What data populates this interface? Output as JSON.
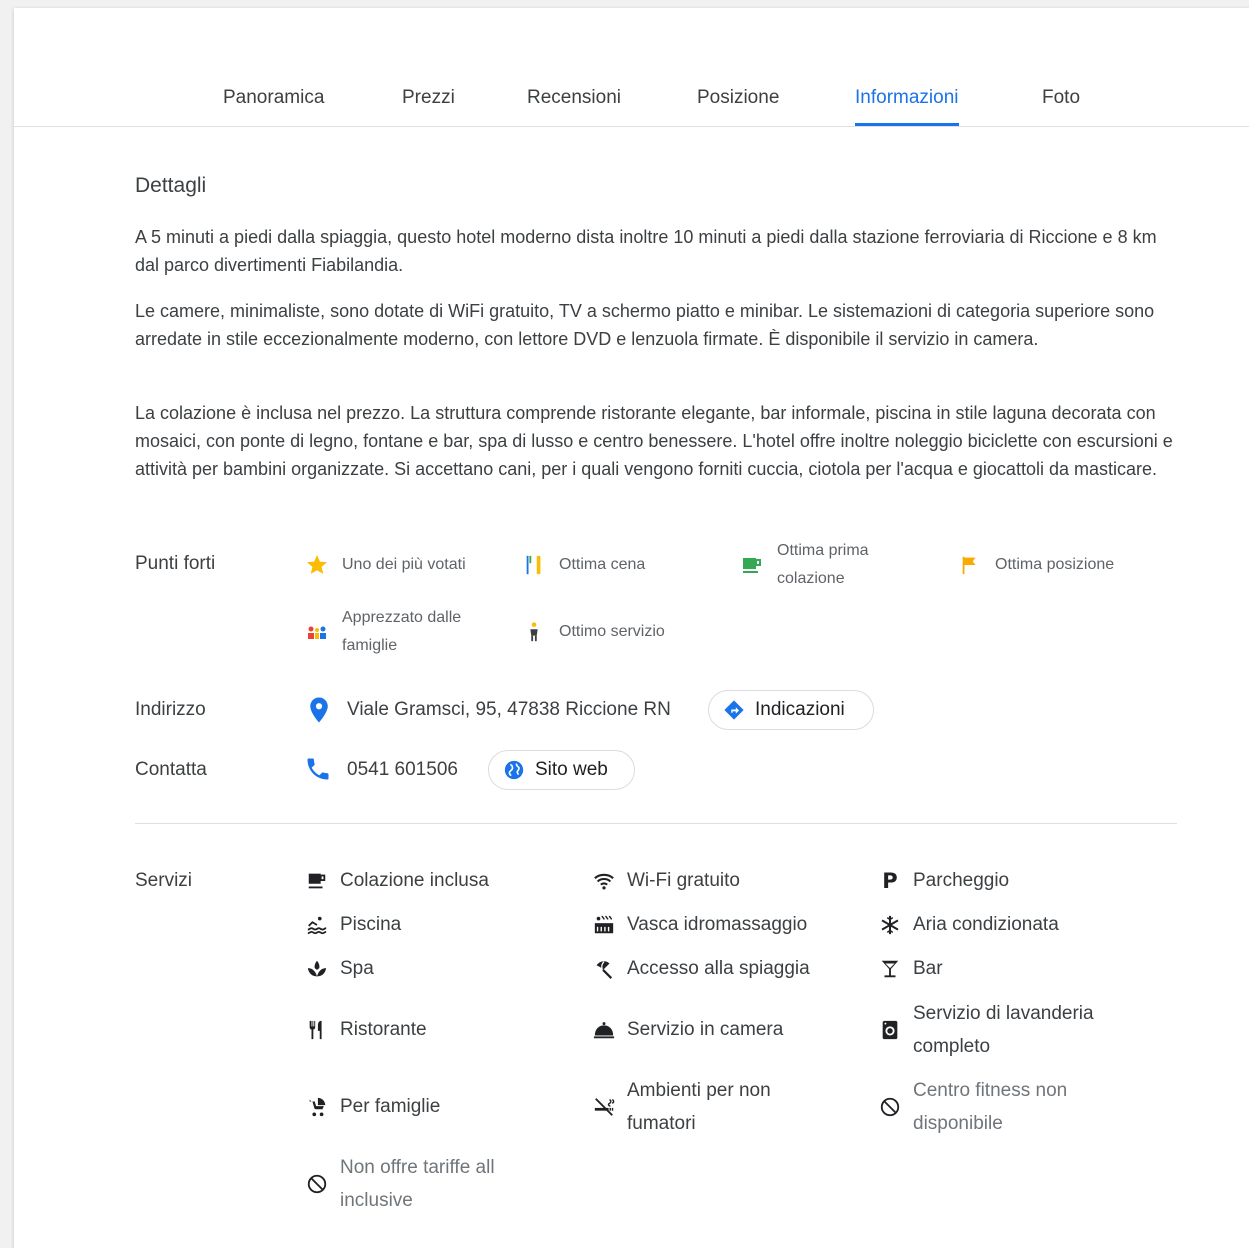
{
  "tabs": [
    {
      "label": "Panoramica",
      "active": false
    },
    {
      "label": "Prezzi",
      "active": false
    },
    {
      "label": "Recensioni",
      "active": false
    },
    {
      "label": "Posizione",
      "active": false
    },
    {
      "label": "Informazioni",
      "active": true
    },
    {
      "label": "Foto",
      "active": false
    }
  ],
  "details": {
    "title": "Dettagli",
    "paragraphs": [
      "A 5 minuti a piedi dalla spiaggia, questo hotel moderno dista inoltre 10 minuti a piedi dalla stazione ferroviaria di Riccione e 8 km dal parco divertimenti Fiabilandia.",
      "Le camere, minimaliste, sono dotate di WiFi gratuito, TV a schermo piatto e minibar. Le sistemazioni di categoria superiore sono arredate in stile eccezionalmente moderno, con lettore DVD e lenzuola firmate. È disponibile il servizio in camera.",
      "La colazione è inclusa nel prezzo. La struttura comprende ristorante elegante, bar informale, piscina in stile laguna decorata con mosaici, con ponte di legno, fontane e bar, spa di lusso e centro benessere. L'hotel offre inoltre noleggio biciclette con escursioni e attività per bambini organizzate. Si accettano cani, per i quali vengono forniti cuccia, ciotola per l'acqua e giocattoli da masticare."
    ]
  },
  "highlights": {
    "label": "Punti forti",
    "items": [
      {
        "text": "Uno dei più votati",
        "icon": "star-icon"
      },
      {
        "text": "Ottima cena",
        "icon": "dinner-icon"
      },
      {
        "text": "Ottima prima colazione",
        "icon": "breakfast-icon"
      },
      {
        "text": "Ottima posizione",
        "icon": "flag-icon"
      },
      {
        "text": "Apprezzato dalle famiglie",
        "icon": "family-icon"
      },
      {
        "text": "Ottimo servizio",
        "icon": "service-icon"
      }
    ]
  },
  "address": {
    "label": "Indirizzo",
    "value": "Viale Gramsci, 95, 47838 Riccione RN",
    "directions_label": "Indicazioni"
  },
  "contact": {
    "label": "Contatta",
    "phone": "0541 601506",
    "website_label": "Sito web"
  },
  "services": {
    "label": "Servizi",
    "items": [
      {
        "text": "Colazione inclusa",
        "icon": "breakfast-icon",
        "available": true
      },
      {
        "text": "Wi-Fi gratuito",
        "icon": "wifi-icon",
        "available": true
      },
      {
        "text": "Parcheggio",
        "icon": "parking-icon",
        "available": true
      },
      {
        "text": "Piscina",
        "icon": "pool-icon",
        "available": true
      },
      {
        "text": "Vasca idromassaggio",
        "icon": "hot-tub-icon",
        "available": true
      },
      {
        "text": "Aria condizionata",
        "icon": "snowflake-icon",
        "available": true
      },
      {
        "text": "Spa",
        "icon": "spa-icon",
        "available": true
      },
      {
        "text": "Accesso alla spiaggia",
        "icon": "beach-icon",
        "available": true
      },
      {
        "text": "Bar",
        "icon": "cocktail-icon",
        "available": true
      },
      {
        "text": "Ristorante",
        "icon": "restaurant-icon",
        "available": true
      },
      {
        "text": "Servizio in camera",
        "icon": "room-service-icon",
        "available": true
      },
      {
        "text": "Servizio di lavanderia completo",
        "icon": "laundry-icon",
        "available": true
      },
      {
        "text": "Per famiglie",
        "icon": "stroller-icon",
        "available": true
      },
      {
        "text": "Ambienti per non fumatori",
        "icon": "no-smoking-icon",
        "available": true
      },
      {
        "text": "Centro fitness non disponibile",
        "icon": "unavailable-icon",
        "available": false
      },
      {
        "text": "Non offre tariffe all inclusive",
        "icon": "unavailable-icon",
        "available": false
      }
    ]
  },
  "colors": {
    "accent": "#1a73e8",
    "text": "#3c4043",
    "muted": "#5f6368",
    "star": "#fbbc04",
    "green": "#34a853",
    "flag": "#f9ab00"
  }
}
